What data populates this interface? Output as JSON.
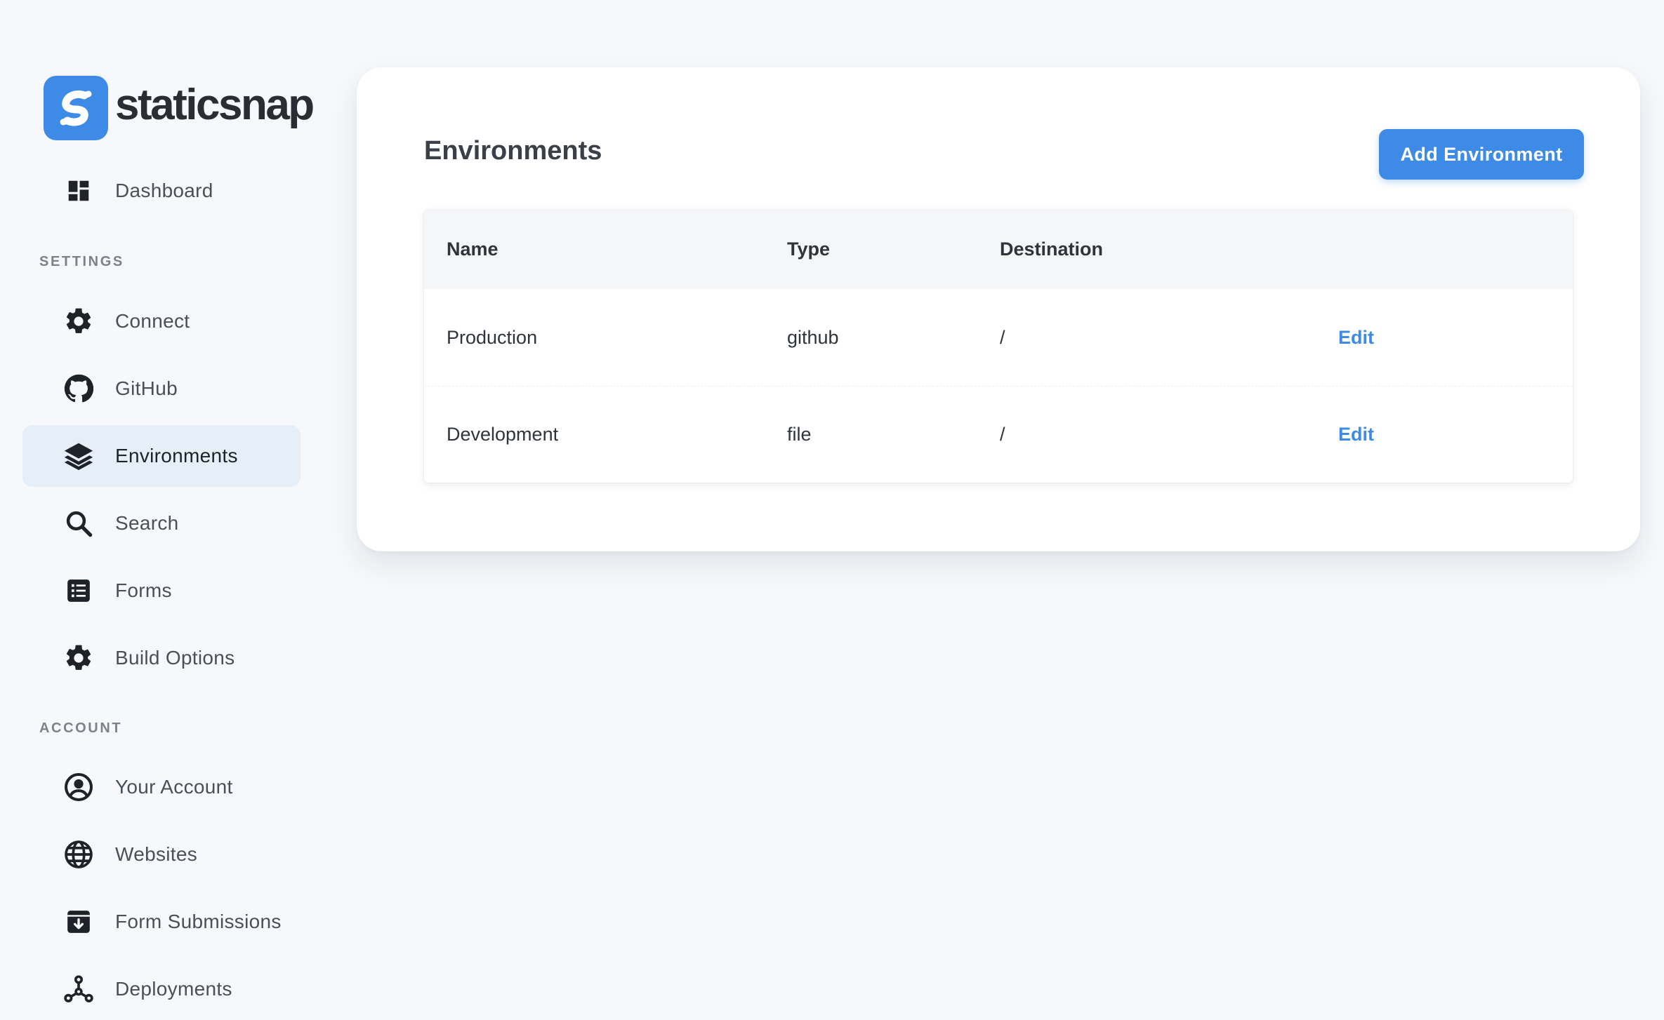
{
  "brand": {
    "name": "staticsnap"
  },
  "sidebar": {
    "top_items": [
      {
        "label": "Dashboard",
        "icon": "dashboard-icon"
      }
    ],
    "sections": [
      {
        "title": "SETTINGS",
        "items": [
          {
            "label": "Connect",
            "icon": "gear-icon",
            "active": false
          },
          {
            "label": "GitHub",
            "icon": "github-icon",
            "active": false
          },
          {
            "label": "Environments",
            "icon": "layers-icon",
            "active": true
          },
          {
            "label": "Search",
            "icon": "search-icon",
            "active": false
          },
          {
            "label": "Forms",
            "icon": "list-icon",
            "active": false
          },
          {
            "label": "Build Options",
            "icon": "gear-icon",
            "active": false
          }
        ]
      },
      {
        "title": "ACCOUNT",
        "items": [
          {
            "label": "Your Account",
            "icon": "user-circle-icon",
            "active": false
          },
          {
            "label": "Websites",
            "icon": "globe-icon",
            "active": false
          },
          {
            "label": "Form Submissions",
            "icon": "inbox-download-icon",
            "active": false
          },
          {
            "label": "Deployments",
            "icon": "nodes-icon",
            "active": false
          }
        ]
      }
    ]
  },
  "main": {
    "title": "Environments",
    "add_button_label": "Add Environment",
    "table": {
      "columns": [
        "Name",
        "Type",
        "Destination",
        ""
      ],
      "rows": [
        {
          "name": "Production",
          "type": "github",
          "destination": "/",
          "action": "Edit"
        },
        {
          "name": "Development",
          "type": "file",
          "destination": "/",
          "action": "Edit"
        }
      ]
    }
  },
  "colors": {
    "accent": "#3d8be6",
    "background": "#f6f8fb",
    "active_nav_bg": "#e6eef8"
  }
}
